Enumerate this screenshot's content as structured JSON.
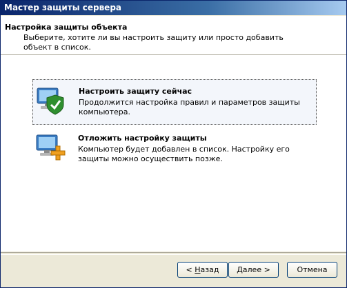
{
  "window": {
    "title": "Мастер защиты сервера"
  },
  "header": {
    "title": "Настройка защиты объекта",
    "description": "Выберите, хотите ли вы настроить защиту или просто добавить объект в список."
  },
  "options": [
    {
      "title": "Настроить защиту сейчас",
      "description": "Продолжится настройка правил и параметров защиты компьютера.",
      "icon": "computer-shield-check-icon",
      "selected": true
    },
    {
      "title": "Отложить настройку защиты",
      "description": "Компьютер будет добавлен в список. Настройку его защиты можно осуществить позже.",
      "icon": "computer-plus-icon",
      "selected": false
    }
  ],
  "buttons": {
    "back_prefix": "< ",
    "back_underlined": "Н",
    "back_rest": "азад",
    "next_underlined": "Д",
    "next_rest": "алее >",
    "cancel": "Отмена"
  }
}
